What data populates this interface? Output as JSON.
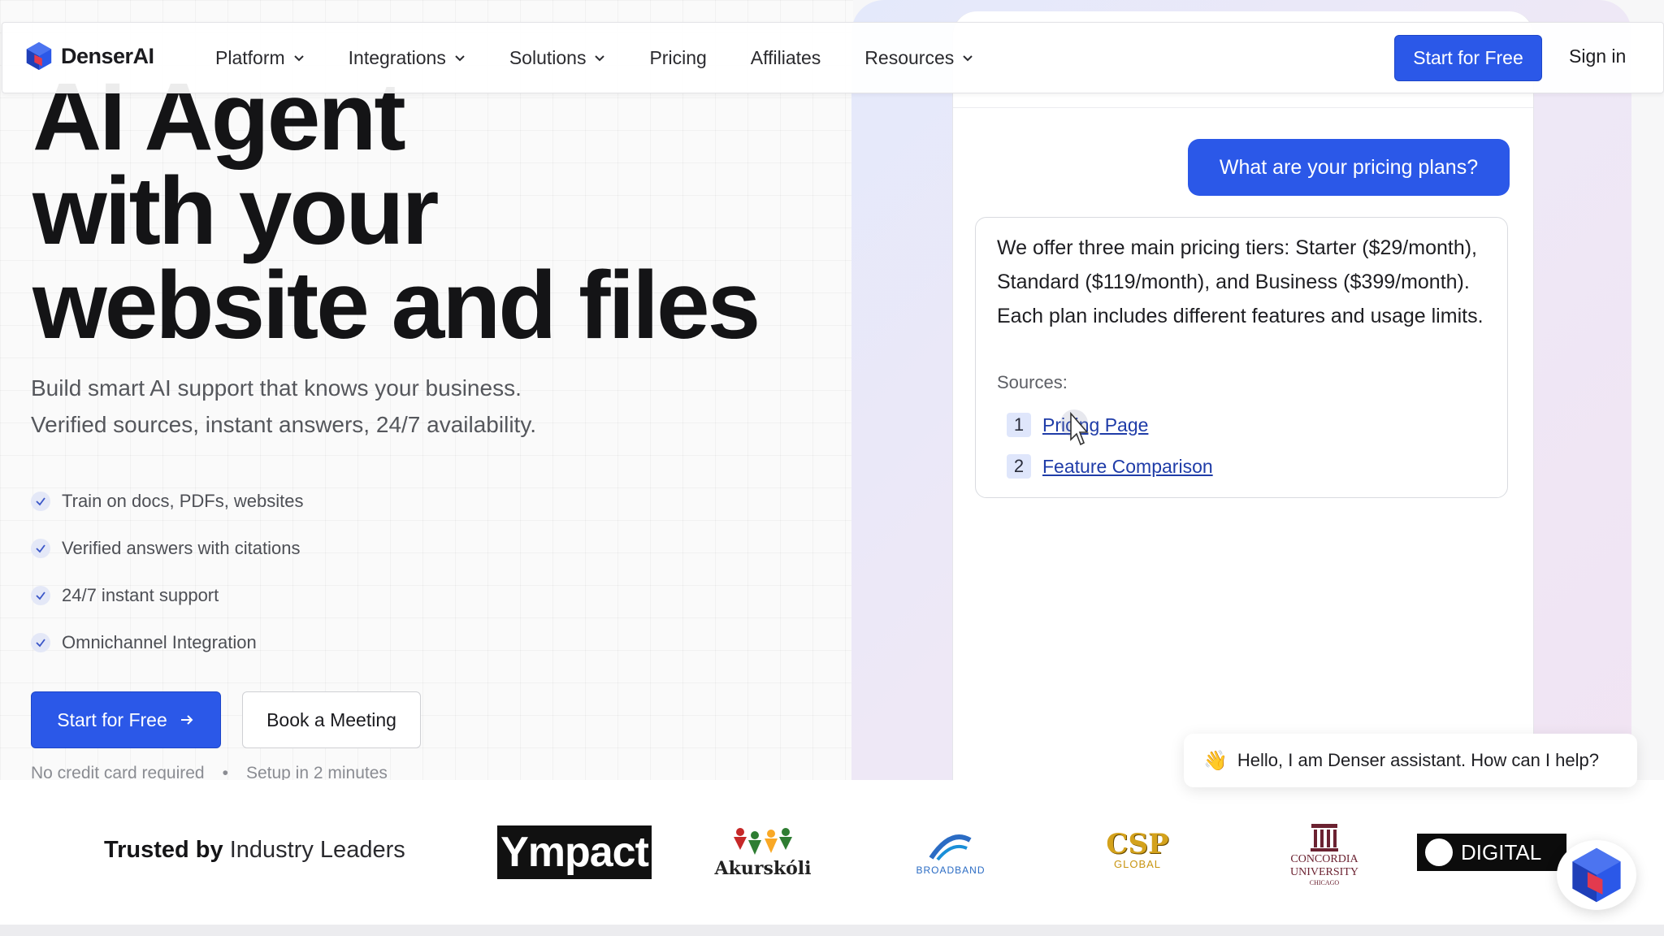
{
  "nav": {
    "brand": "DenserAI",
    "items": [
      {
        "label": "Platform",
        "dropdown": true
      },
      {
        "label": "Integrations",
        "dropdown": true
      },
      {
        "label": "Solutions",
        "dropdown": true
      },
      {
        "label": "Pricing",
        "dropdown": false
      },
      {
        "label": "Affiliates",
        "dropdown": false
      },
      {
        "label": "Resources",
        "dropdown": true
      }
    ],
    "cta": "Start for Free",
    "signin": "Sign in"
  },
  "hero": {
    "headline_lines": [
      "AI Agent",
      "with your",
      "website and files"
    ],
    "subtitle_lines": [
      "Build smart AI support that knows your business.",
      "Verified sources, instant answers, 24/7 availability."
    ],
    "features": [
      "Train on docs, PDFs, websites",
      "Verified answers with citations",
      "24/7 instant support",
      "Omnichannel Integration"
    ],
    "primary_button": "Start for Free",
    "secondary_button": "Book a Meeting",
    "notes": [
      "No credit card required",
      "Setup in 2 minutes"
    ]
  },
  "chat_demo": {
    "user_message": "What are your pricing plans?",
    "bot_message": "We offer three main pricing tiers: Starter ($29/month), Standard ($119/month), and Business ($399/month). Each plan includes different features and usage limits.",
    "sources_label": "Sources:",
    "sources": [
      {
        "num": "1",
        "label": "Pricing Page"
      },
      {
        "num": "2",
        "label": "Feature Comparison"
      }
    ]
  },
  "assistant_popup": {
    "emoji": "👋",
    "text": "Hello, I am Denser assistant. How can I help?"
  },
  "trusted": {
    "bold": "Trusted by",
    "rest": "Industry Leaders",
    "logos": {
      "impact": "Ympact",
      "akurskoli": "Akurskóli",
      "broadband": "BROADBAND",
      "csp_big": "CSP",
      "csp_small": "GLOBAL",
      "concordia_1": "CONCORDIA",
      "concordia_2": "UNIVERSITY",
      "concordia_3": "CHICAGO",
      "digital": "DIGITAL"
    }
  },
  "colors": {
    "accent": "#2b58e8",
    "link": "#1f3ca8"
  }
}
